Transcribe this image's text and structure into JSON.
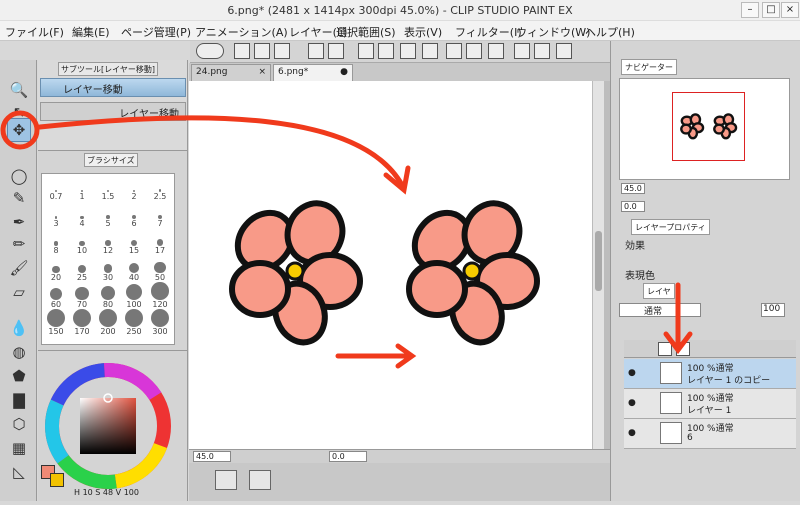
{
  "window": {
    "title": "6.png* (2481 x 1414px 300dpi 45.0%) - CLIP STUDIO PAINT EX"
  },
  "menu": [
    "ファイル(F)",
    "編集(E)",
    "ページ管理(P)",
    "アニメーション(A)",
    "レイヤー(L)",
    "選択範囲(S)",
    "表示(V)",
    "フィルター(I)",
    "ウィンドウ(W)",
    "ヘルプ(H)"
  ],
  "subtool": {
    "tab": "サブツール[レイヤー移動]",
    "btn1": "レイヤー移動",
    "btn2": "レイヤー移動"
  },
  "brush": {
    "tab": "ブラシサイズ",
    "sizes": [
      "0.7",
      "1",
      "1.5",
      "2",
      "2.5",
      "3",
      "4",
      "5",
      "6",
      "7",
      "8",
      "10",
      "12",
      "15",
      "17",
      "20",
      "25",
      "30",
      "40",
      "50",
      "60",
      "70",
      "80",
      "100",
      "120",
      "150",
      "170",
      "200",
      "250",
      "300"
    ]
  },
  "color": {
    "h": "H",
    "h_val": "10",
    "s": "S",
    "s_val": "48",
    "v": "V",
    "v_val": "100",
    "accent": "#f08a76",
    "secondary": "#f2c200"
  },
  "doc_tabs": [
    "24.png",
    "6.png*"
  ],
  "canvas": {
    "zoom": "45.0",
    "angle": "0.0",
    "petal_color": "#f89a88",
    "center_color": "#f7cc00"
  },
  "right": {
    "nav_tab": "ナビゲーター",
    "nav_zoom": "45.0",
    "nav_angle": "0.0",
    "prop_tab": "レイヤープロパティ",
    "effect_label": "効果",
    "display_color_label": "表現色",
    "layer_tab": "レイヤ",
    "blend": "通常",
    "opacity": "100",
    "layers": [
      {
        "pct": "100 %通常",
        "name": "レイヤー 1 のコピー"
      },
      {
        "pct": "100 %通常",
        "name": "レイヤー 1"
      },
      {
        "pct": "100 %通常",
        "name": "6"
      }
    ]
  },
  "annotation_color": "#f03a1c"
}
